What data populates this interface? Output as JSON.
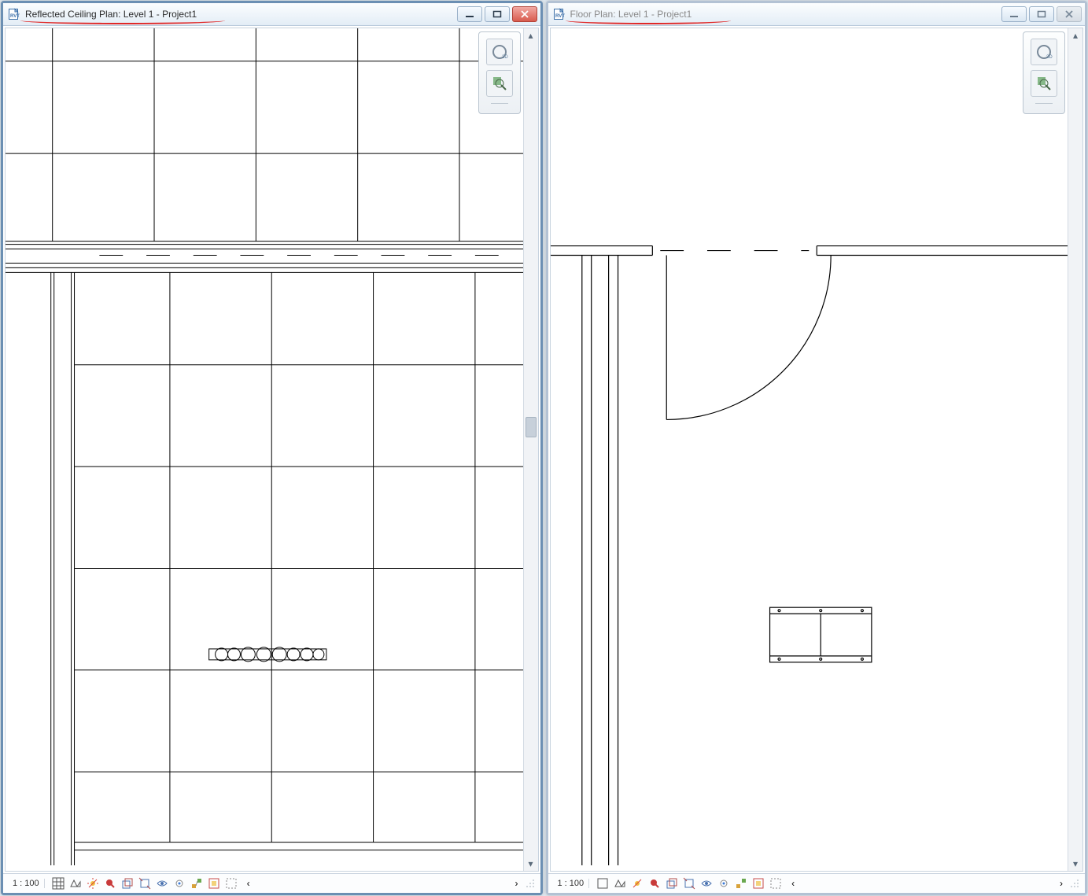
{
  "panes": [
    {
      "id": "left",
      "active": true,
      "title": "Reflected Ceiling Plan: Level 1 - Project1",
      "scale": "1 : 100",
      "close_disabled": false
    },
    {
      "id": "right",
      "active": false,
      "title": "Floor Plan: Level 1 - Project1",
      "scale": "1 : 100",
      "close_disabled": true
    }
  ],
  "nav_tools": [
    "orbit-2d",
    "zoom-region"
  ],
  "status_tools": [
    "detail-level",
    "model-graphics",
    "sun-path",
    "shadows",
    "crop-view",
    "crop-region",
    "temp-hide",
    "reveal-hidden",
    "worksharing",
    "reveal-constraints",
    "analytical",
    "highlight",
    "more"
  ]
}
